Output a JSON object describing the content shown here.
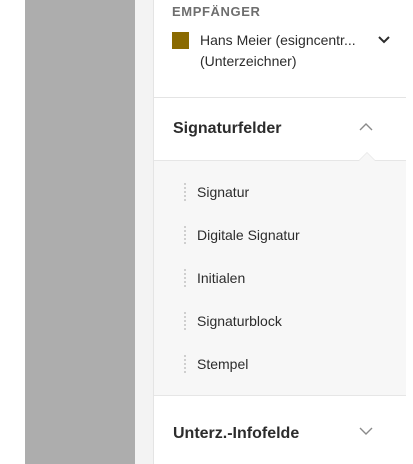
{
  "recipient": {
    "header": "EMPFÄNGER",
    "name": "Hans Meier (esigncentr...",
    "role": "(Unterzeichner)",
    "swatch_color": "#8a6a00",
    "chevron_icon": "chevron-down-icon"
  },
  "sections": {
    "signature_fields": {
      "title": "Signaturfelder",
      "chevron_icon": "chevron-up-icon",
      "expanded": true,
      "items": [
        {
          "label": "Signatur"
        },
        {
          "label": "Digitale Signatur"
        },
        {
          "label": "Initialen"
        },
        {
          "label": "Signaturblock"
        },
        {
          "label": "Stempel"
        }
      ]
    },
    "signer_info_fields": {
      "title": "Unterz.-Infofelde",
      "chevron_icon": "chevron-down-icon",
      "expanded": false
    }
  }
}
